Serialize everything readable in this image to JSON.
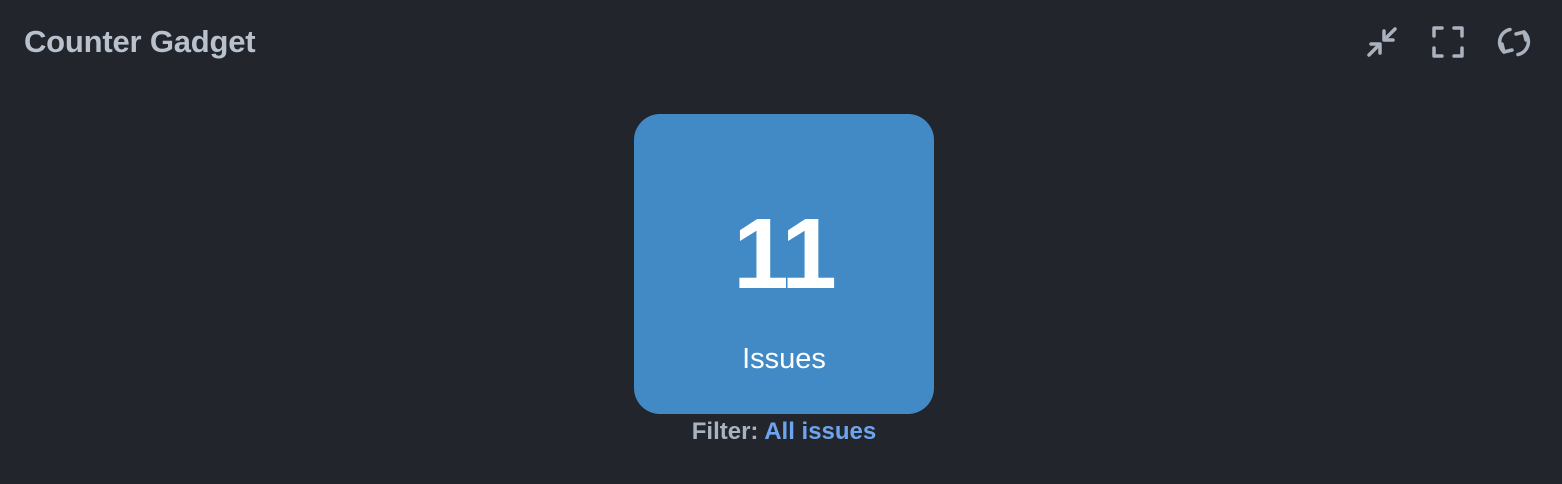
{
  "gadget": {
    "title": "Counter Gadget",
    "toolbar": {
      "minimize_icon": "minimize-arrows-icon",
      "fullscreen_icon": "fullscreen-corners-icon",
      "refresh_icon": "refresh-arrows-icon"
    },
    "counter": {
      "value": "11",
      "label": "Issues",
      "color": "#418ac5"
    },
    "filter": {
      "label": "Filter:",
      "value": "All issues"
    }
  }
}
